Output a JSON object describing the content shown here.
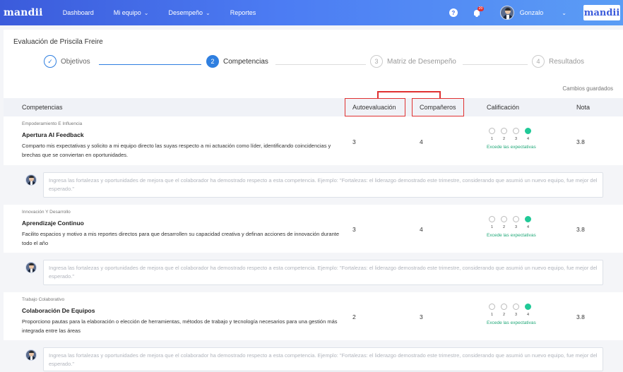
{
  "nav": {
    "logo": "mandii",
    "items": [
      {
        "label": "Dashboard",
        "has_dropdown": false
      },
      {
        "label": "Mi equipo",
        "has_dropdown": true
      },
      {
        "label": "Desempeño",
        "has_dropdown": true
      },
      {
        "label": "Reportes",
        "has_dropdown": false
      }
    ],
    "help_label": "?",
    "notification_count": "20",
    "user_name": "Gonzalo",
    "brand_label": "mandii"
  },
  "page": {
    "title": "Evaluación de Priscila Freire",
    "saved_status": "Cambios guardados"
  },
  "steps": [
    {
      "number": "✓",
      "label": "Objetivos",
      "state": "done"
    },
    {
      "number": "2",
      "label": "Competencias",
      "state": "active"
    },
    {
      "number": "3",
      "label": "Matriz de Desempeño",
      "state": "todo"
    },
    {
      "number": "4",
      "label": "Resultados",
      "state": "todo"
    }
  ],
  "table": {
    "headers": {
      "competencias": "Competencias",
      "autoevaluacion": "Autoevaluación",
      "companeros": "Compañeros",
      "calificacion": "Calificación",
      "nota": "Nota"
    },
    "rating_scale": [
      "1",
      "2",
      "3",
      "4"
    ],
    "rows": [
      {
        "category": "Empoderamiento E Influencia",
        "name": "Apertura Al Feedback",
        "description": "Comparto mis expectativas y solicito a mi equipo directo las suyas respecto a mi actuación como líder, identificando coincidencias y brechas que se conviertan en oportunidades.",
        "autoevaluacion": "3",
        "companeros": "4",
        "selected_rating": 4,
        "rating_label": "Excede las expectativas",
        "nota": "3.8"
      },
      {
        "category": "Innovación Y Desarrollo",
        "name": "Aprendizaje Continuo",
        "description": "Facilito espacios y motivo a mis reportes directos para que desarrollen su capacidad creativa y definan acciones de innovación durante todo el año",
        "autoevaluacion": "3",
        "companeros": "4",
        "selected_rating": 4,
        "rating_label": "Excede las expectativas",
        "nota": "3.8"
      },
      {
        "category": "Trabajo Colaborativo",
        "name": "Colaboración De Equipos",
        "description": "Proporciono pautas para la elaboración o elección de herramientas, métodos de trabajo y tecnología necesarios para una gestión más integrada entre las áreas",
        "autoevaluacion": "2",
        "companeros": "3",
        "selected_rating": 4,
        "rating_label": "Excede las expectativas",
        "nota": "3.8"
      }
    ],
    "feedback_placeholder": "Ingresa las fortalezas y oportunidades de mejora que el colaborador ha demostrado respecto a esta competencia. Ejemplo: \"Fortalezas: el liderazgo demostrado este trimestre, considerando que asumió un nuevo equipo, fue mejor del esperado.\""
  },
  "colors": {
    "nav_gradient_start": "#3b5bdb",
    "nav_gradient_end": "#5b9df5",
    "step_active": "#2f7fe0",
    "rating_selected": "#20c997",
    "highlight_red": "#e03131"
  }
}
